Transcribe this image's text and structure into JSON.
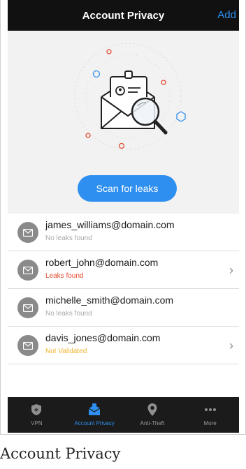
{
  "header": {
    "title": "Account Privacy",
    "add_label": "Add"
  },
  "hero": {
    "scan_button_label": "Scan for leaks"
  },
  "accounts": [
    {
      "email": "james_williams@domain.com",
      "status": "No leaks found",
      "status_type": "ok",
      "has_chevron": false
    },
    {
      "email": "robert_john@domain.com",
      "status": "Leaks found",
      "status_type": "leak",
      "has_chevron": true
    },
    {
      "email": "michelle_smith@domain.com",
      "status": "No leaks found",
      "status_type": "ok",
      "has_chevron": false
    },
    {
      "email": "davis_jones@domain.com",
      "status": "Not Validated",
      "status_type": "not-validated",
      "has_chevron": true
    }
  ],
  "status_colors": {
    "ok": "#a9a9a9",
    "leak": "#e24b2f",
    "not_validated": "#f2b531"
  },
  "accent_color": "#2f8ff0",
  "tabs": [
    {
      "label": "VPN",
      "icon": "shield-icon",
      "active": false
    },
    {
      "label": "Account Privacy",
      "icon": "account-privacy-icon",
      "active": true
    },
    {
      "label": "Anti-Theft",
      "icon": "location-pin-icon",
      "active": false
    },
    {
      "label": "More",
      "icon": "more-dots-icon",
      "active": false
    }
  ],
  "caption": "Account Privacy"
}
